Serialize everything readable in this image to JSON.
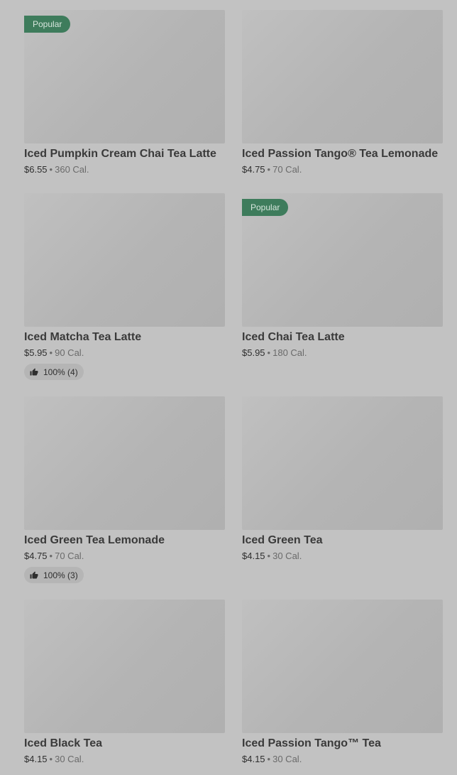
{
  "items": [
    {
      "name": "Iced Pumpkin Cream Chai Tea Latte",
      "price": "$6.55",
      "sep": "•",
      "calories": "360 Cal.",
      "badge": "Popular",
      "rating": ""
    },
    {
      "name": "Iced Passion Tango® Tea Lemonade",
      "price": "$4.75",
      "sep": "•",
      "calories": "70 Cal.",
      "badge": "",
      "rating": ""
    },
    {
      "name": "Iced Matcha Tea Latte",
      "price": "$5.95",
      "sep": "•",
      "calories": "90 Cal.",
      "badge": "",
      "rating": "100% (4)"
    },
    {
      "name": "Iced Chai Tea Latte",
      "price": "$5.95",
      "sep": "•",
      "calories": "180 Cal.",
      "badge": "Popular",
      "rating": ""
    },
    {
      "name": "Iced Green Tea Lemonade",
      "price": "$4.75",
      "sep": "•",
      "calories": "70 Cal.",
      "badge": "",
      "rating": "100% (3)"
    },
    {
      "name": "Iced Green Tea",
      "price": "$4.15",
      "sep": "•",
      "calories": "30 Cal.",
      "badge": "",
      "rating": ""
    },
    {
      "name": "Iced Black Tea",
      "price": "$4.15",
      "sep": "•",
      "calories": "30 Cal.",
      "badge": "",
      "rating": ""
    },
    {
      "name": "Iced Passion Tango™ Tea",
      "price": "$4.15",
      "sep": "•",
      "calories": "30 Cal.",
      "badge": "",
      "rating": ""
    }
  ],
  "icons": {
    "rating": "thumbs-up-icon"
  },
  "colors": {
    "badge_bg": "#3e7c5c",
    "background": "#c2c2c2"
  }
}
